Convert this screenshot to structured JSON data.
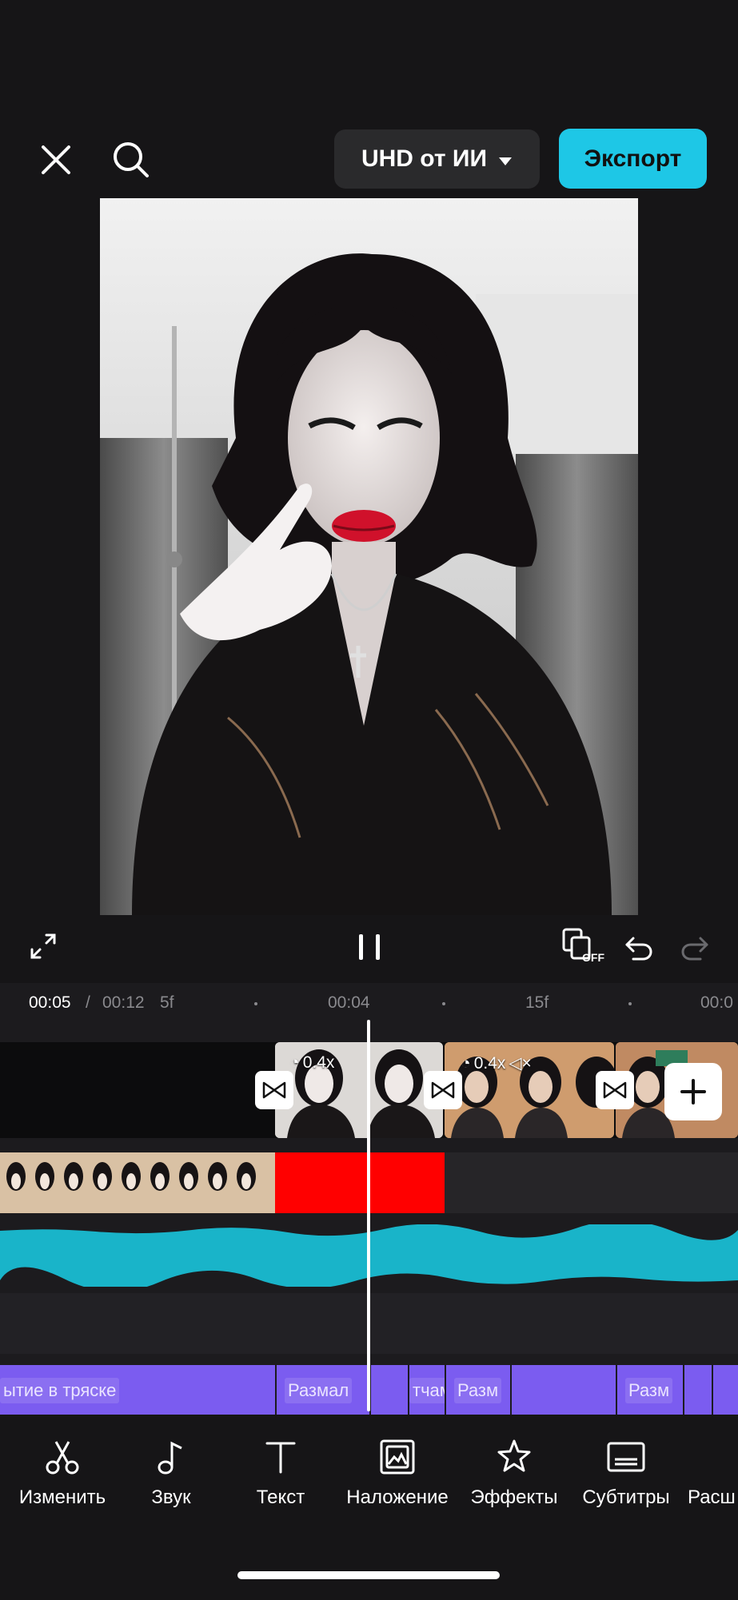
{
  "header": {
    "resolution_label": "UHD от ИИ",
    "export_label": "Экспорт"
  },
  "icons": {
    "close": "close-icon",
    "search": "search-icon",
    "dropdown": "caret-down-icon",
    "fullscreen": "expand-icon",
    "pause": "pause-icon",
    "keyframe": "keyframe-off-icon",
    "undo": "undo-icon",
    "redo": "redo-icon"
  },
  "player": {
    "keyframe_badge": "OFF"
  },
  "ruler": {
    "current_time": "00:05",
    "separator": "/",
    "total_time": "00:12",
    "ticks": [
      "5f",
      "00:04",
      "15f",
      "00:0"
    ]
  },
  "timeline": {
    "clip_speeds": [
      "0.4x",
      "0.4x"
    ],
    "effects": [
      "ытие в тряске",
      "Размал",
      "тчам",
      "Разм",
      "Разм"
    ]
  },
  "toolbar": {
    "items": [
      {
        "label": "Изменить",
        "icon": "scissors-icon"
      },
      {
        "label": "Звук",
        "icon": "music-note-icon"
      },
      {
        "label": "Текст",
        "icon": "text-icon"
      },
      {
        "label": "Наложение",
        "icon": "overlay-icon"
      },
      {
        "label": "Эффекты",
        "icon": "star-effects-icon"
      },
      {
        "label": "Субтитры",
        "icon": "subtitles-icon"
      },
      {
        "label": "Расш",
        "icon": "extend-icon"
      }
    ]
  },
  "colors": {
    "accent": "#1ec7e6",
    "audio_track": "#19b4c9",
    "effect_track": "#7b5cf0",
    "red_clip": "#ff0000"
  }
}
